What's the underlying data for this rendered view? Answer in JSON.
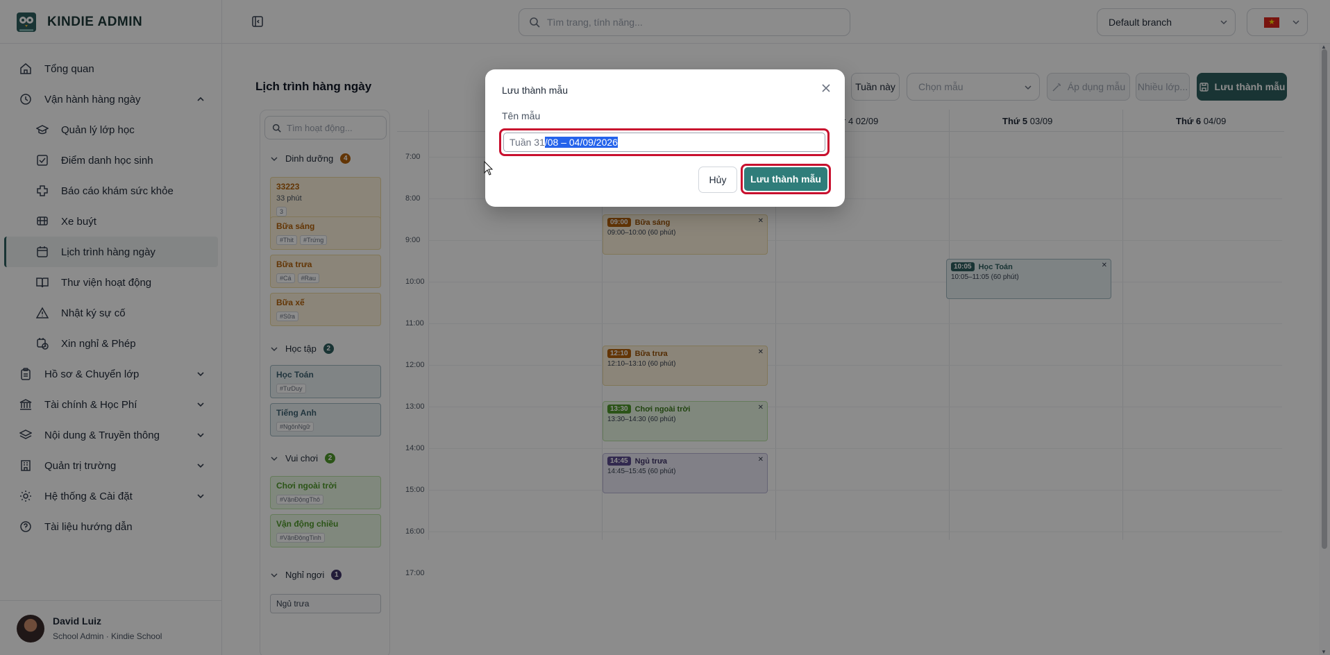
{
  "brand": {
    "name": "KINDIE ADMIN"
  },
  "sidebar": {
    "items": [
      {
        "label": "Tổng quan",
        "icon": "home-icon"
      },
      {
        "label": "Vận hành hàng ngày",
        "icon": "clock-icon",
        "expanded": true
      },
      {
        "label": "Quản lý lớp học",
        "icon": "graduation-cap-icon"
      },
      {
        "label": "Điểm danh học sinh",
        "icon": "checkbox-icon"
      },
      {
        "label": "Báo cáo khám sức khỏe",
        "icon": "health-cross-icon"
      },
      {
        "label": "Xe buýt",
        "icon": "bus-icon"
      },
      {
        "label": "Lịch trình hàng ngày",
        "icon": "calendar-icon",
        "active": true
      },
      {
        "label": "Thư viện hoạt động",
        "icon": "book-icon"
      },
      {
        "label": "Nhật ký sự cố",
        "icon": "warning-icon"
      },
      {
        "label": "Xin nghỉ & Phép",
        "icon": "calendar-clock-icon"
      },
      {
        "label": "Hồ sơ & Chuyển lớp",
        "icon": "clipboard-icon"
      },
      {
        "label": "Tài chính & Học Phí",
        "icon": "bank-icon"
      },
      {
        "label": "Nội dung & Truyền thông",
        "icon": "layers-icon"
      },
      {
        "label": "Quản trị trường",
        "icon": "building-icon"
      },
      {
        "label": "Hệ thống & Cài đặt",
        "icon": "gear-icon"
      },
      {
        "label": "Tài liệu hướng dẫn",
        "icon": "help-circle-icon"
      }
    ]
  },
  "user": {
    "name": "David Luiz",
    "role": "School Admin · Kindie School"
  },
  "topbar": {
    "search_placeholder": "Tìm trang, tính năng...",
    "branch": "Default branch"
  },
  "page": {
    "title": "Lịch trình hàng ngày",
    "this_week": "Tuần này",
    "template_placeholder": "Chọn mẫu",
    "apply_template": "Áp dụng mẫu",
    "multi_class": "Nhiều lớp...",
    "save_template": "Lưu thành mẫu"
  },
  "panel": {
    "search_placeholder": "Tìm hoạt động...",
    "categories": [
      {
        "label": "Dinh dưỡng",
        "count": "4",
        "color": "#b4620a"
      },
      {
        "label": "Học tập",
        "count": "2",
        "color": "#2f5f5f"
      },
      {
        "label": "Vui chơi",
        "count": "2",
        "color": "#4f9a2a"
      },
      {
        "label": "Nghỉ ngơi",
        "count": "1",
        "color": "#3f3468"
      }
    ],
    "activities": [
      {
        "title": "33223",
        "duration": "33 phút",
        "tags": [
          "3"
        ]
      },
      {
        "title": "Bữa sáng",
        "tags": [
          "#Thit",
          "#Trứng"
        ]
      },
      {
        "title": "Bữa trưa",
        "tags": [
          "#Cá",
          "#Rau"
        ]
      },
      {
        "title": "Bữa xế",
        "tags": [
          "#Sữa"
        ]
      },
      {
        "title": "Học Toán",
        "tags": [
          "#TưDuy"
        ]
      },
      {
        "title": "Tiếng Anh",
        "tags": [
          "#NgônNgữ"
        ]
      },
      {
        "title": "Chơi ngoài trời",
        "tags": [
          "#VậnĐộngThô"
        ]
      },
      {
        "title": "Vận động chiều",
        "tags": [
          "#VậnĐộngTinh"
        ]
      },
      {
        "title": "Ngủ trưa",
        "tags": []
      }
    ]
  },
  "calendar": {
    "days": [
      {
        "name": "r 4",
        "date": "02/09"
      },
      {
        "name": "Thứ 5",
        "date": "03/09"
      },
      {
        "name": "Thứ 6",
        "date": "04/09"
      }
    ],
    "hours": [
      "7:00",
      "8:00",
      "9:00",
      "10:00",
      "11:00",
      "12:00",
      "13:00",
      "14:00",
      "15:00",
      "16:00",
      "17:00"
    ],
    "events": [
      {
        "time": "09:00",
        "name": "Bữa sáng",
        "range": "09:00–10:00 (60 phút)"
      },
      {
        "time": "12:10",
        "name": "Bữa trưa",
        "range": "12:10–13:10 (60 phút)"
      },
      {
        "time": "13:30",
        "name": "Chơi ngoài trời",
        "range": "13:30–14:30 (60 phút)"
      },
      {
        "time": "14:45",
        "name": "Ngủ trưa",
        "range": "14:45–15:45 (60 phút)"
      },
      {
        "time": "10:05",
        "name": "Học Toán",
        "range": "10:05–11:05 (60 phút)"
      }
    ]
  },
  "modal": {
    "title": "Lưu thành mẫu",
    "field_label": "Tên mẫu",
    "value_unselected": "Tuần 31",
    "value_selected": "/08 – 04/09/2026",
    "cancel": "Hủy",
    "save": "Lưu thành mẫu"
  }
}
